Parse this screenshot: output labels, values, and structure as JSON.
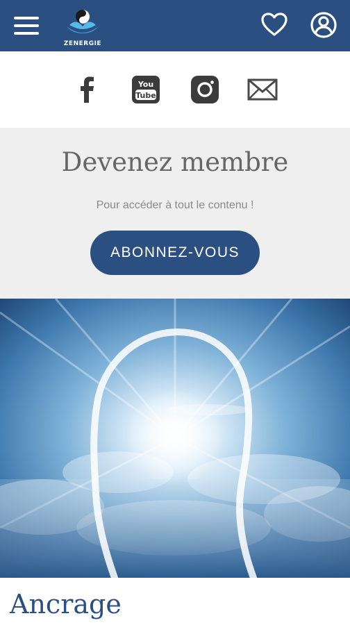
{
  "header": {
    "logo_text": "ZENERGIE",
    "icons": [
      "menu-icon",
      "heart-icon",
      "user-icon"
    ]
  },
  "social": {
    "icons": [
      "facebook-icon",
      "youtube-icon",
      "instagram-icon",
      "mail-icon"
    ],
    "youtube_top": "You",
    "youtube_bottom": "Tube"
  },
  "membership": {
    "title": "Devenez membre",
    "subtitle": "Pour accéder à tout le contenu !",
    "button_label": "ABONNEZ-VOUS"
  },
  "article": {
    "title": "Ancrage"
  },
  "colors": {
    "brand": "#2b4f80",
    "background_grey": "#efefef",
    "title_grey": "#666666"
  }
}
